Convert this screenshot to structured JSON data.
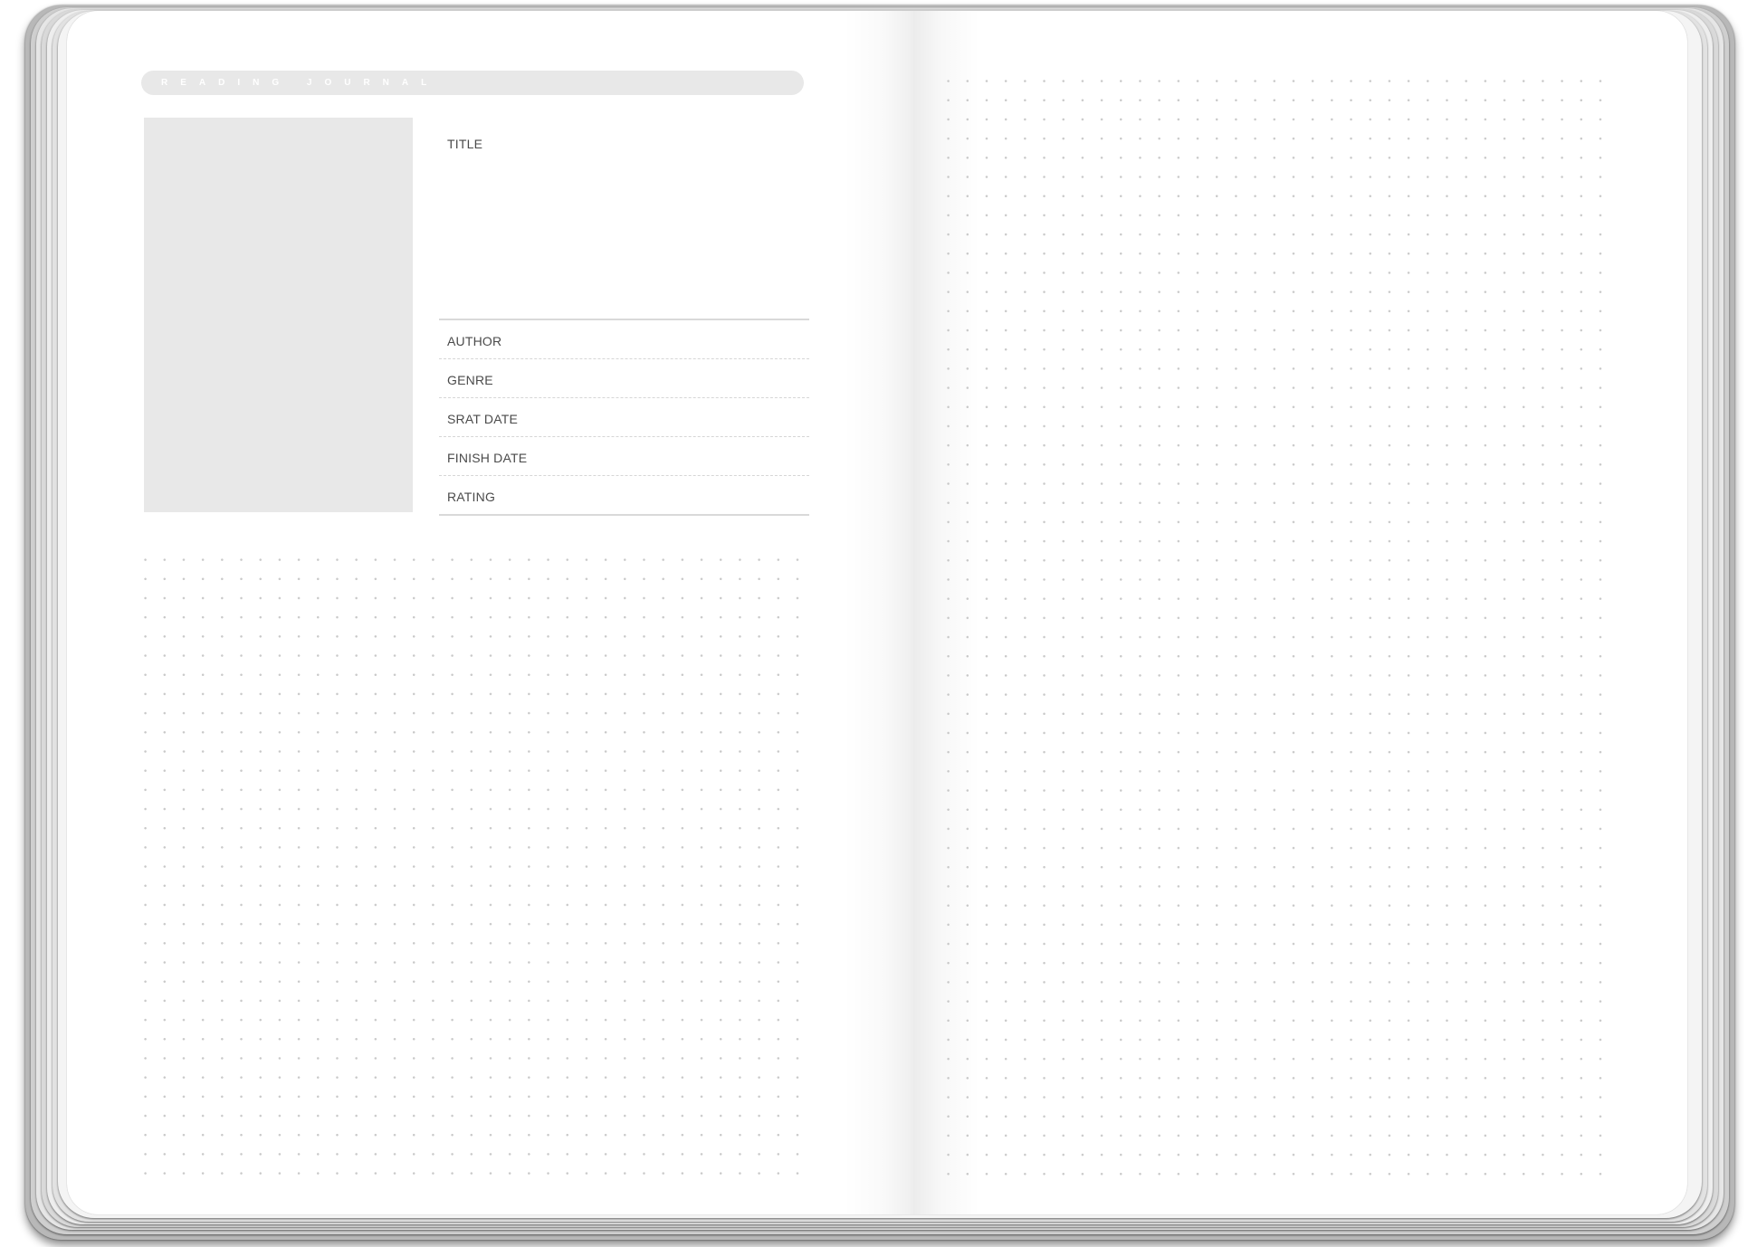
{
  "journal": {
    "banner_title": "READING JOURNAL",
    "fields": {
      "title": "TITLE",
      "author": "AUTHOR",
      "genre": "GENRE",
      "start_date": "SRAT DATE",
      "finish_date": "FINISH DATE",
      "rating": "RATING"
    }
  },
  "colors": {
    "banner": "#e8e8e8",
    "cover_placeholder": "#e8e8e8",
    "dot": "#c9c9c9",
    "label_text": "#4a4a4a"
  }
}
